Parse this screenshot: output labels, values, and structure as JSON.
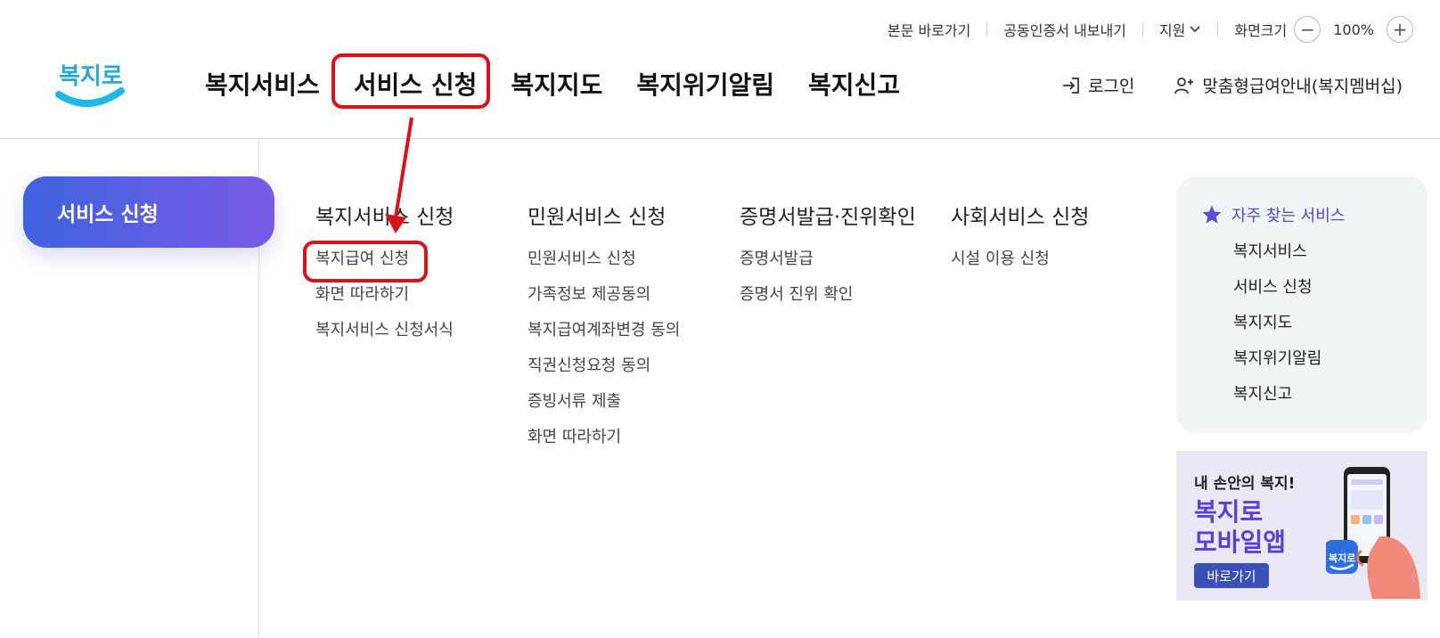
{
  "utility": {
    "skip_link": "본문 바로가기",
    "cert_export": "공동인증서 내보내기",
    "language": "지원",
    "zoom_label": "화면크기",
    "zoom_value": "100%",
    "zoom_out": "−",
    "zoom_in": "+"
  },
  "logo": {
    "text": "복지로"
  },
  "gnb": {
    "items": [
      {
        "label": "복지서비스"
      },
      {
        "label": "서비스 신청"
      },
      {
        "label": "복지지도"
      },
      {
        "label": "복지위기알림"
      },
      {
        "label": "복지신고"
      }
    ]
  },
  "header_links": {
    "login": "로그인",
    "membership": "맞춤형급여안내(복지멤버십)"
  },
  "side": {
    "title": "서비스 신청"
  },
  "menu": {
    "columns": [
      {
        "title": "복지서비스 신청",
        "items": [
          "복지급여 신청",
          "화면 따라하기",
          "복지서비스 신청서식"
        ]
      },
      {
        "title": "민원서비스 신청",
        "items": [
          "민원서비스 신청",
          "가족정보 제공동의",
          "복지급여계좌변경 동의",
          "직권신청요청 동의",
          "증빙서류 제출",
          "화면 따라하기"
        ]
      },
      {
        "title": "증명서발급·진위확인",
        "items": [
          "증명서발급",
          "증명서 진위 확인"
        ]
      },
      {
        "title": "사회서비스 신청",
        "items": [
          "시설 이용 신청"
        ]
      }
    ]
  },
  "favorites": {
    "title": "자주 찾는 서비스",
    "items": [
      "복지서비스",
      "서비스 신청",
      "복지지도",
      "복지위기알림",
      "복지신고"
    ]
  },
  "banner": {
    "line1": "내 손안의 복지!",
    "line2": "복지로",
    "line3": "모바일앱",
    "button": "바로가기",
    "app_label": "복지로"
  },
  "colors": {
    "highlight": "#d9121b",
    "accent": "#5548c8",
    "pill_start": "#3f63de",
    "pill_end": "#7a5ae6"
  }
}
